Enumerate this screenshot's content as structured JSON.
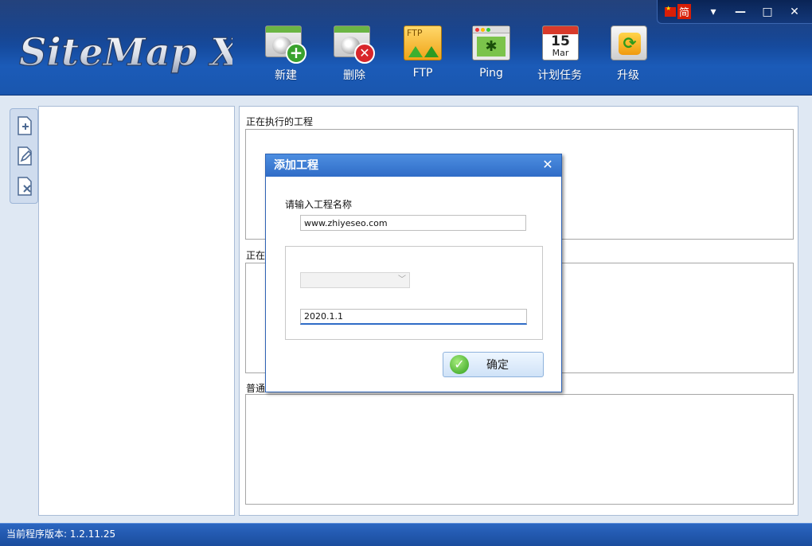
{
  "app": {
    "logo_text": "SiteMap X",
    "lang_label": "简",
    "window_controls": {
      "menu": "▾",
      "minimize": "—",
      "maximize": "□",
      "close": "✕"
    }
  },
  "toolbar": [
    {
      "label": "新建",
      "icon": "new-project-icon"
    },
    {
      "label": "删除",
      "icon": "delete-project-icon"
    },
    {
      "label": "FTP",
      "icon": "ftp-icon"
    },
    {
      "label": "Ping",
      "icon": "ping-icon"
    },
    {
      "label": "计划任务",
      "icon": "calendar-icon"
    },
    {
      "label": "升级",
      "icon": "upgrade-icon"
    }
  ],
  "icons": {
    "ftp_text": "FTP",
    "calendar_day": "15",
    "calendar_month": "Mar"
  },
  "sidebar_icons": [
    "add-page-icon",
    "edit-page-icon",
    "delete-page-icon"
  ],
  "sections": {
    "running": "正在执行的工程",
    "waiting": "正在",
    "normal": "普通"
  },
  "dialog": {
    "title": "添加工程",
    "close": "✕",
    "name_label": "请输入工程名称",
    "name_value": "www.zhiyeseo.com",
    "select_value": "",
    "version_value": "2020.1.1",
    "ok_label": "确定"
  },
  "status": {
    "version_label": "当前程序版本: 1.2.11.25"
  }
}
